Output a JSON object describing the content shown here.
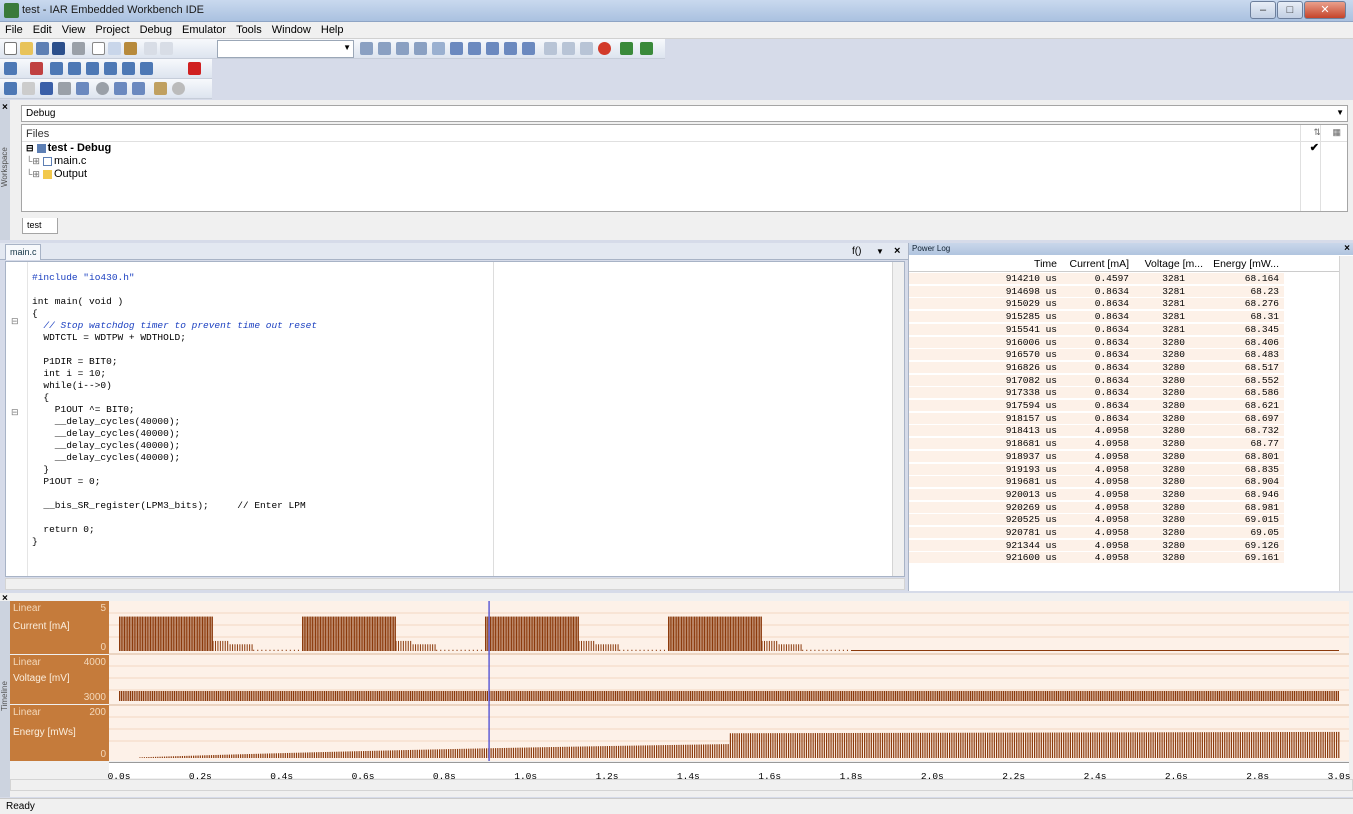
{
  "window": {
    "title": "test - IAR Embedded Workbench IDE"
  },
  "menu": [
    "File",
    "Edit",
    "View",
    "Project",
    "Debug",
    "Emulator",
    "Tools",
    "Window",
    "Help"
  ],
  "workspace": {
    "config": "Debug",
    "files_header": "Files",
    "project": "test - Debug",
    "items": [
      "main.c",
      "Output"
    ],
    "tab": "test",
    "sidebar_label": "Workspace"
  },
  "editor": {
    "tab": "main.c",
    "func_combo": "f()",
    "lines": [
      {
        "t": "#include \"io430.h\"",
        "k": "pre"
      },
      {
        "t": "",
        "k": ""
      },
      {
        "t": "int main( void )",
        "k": ""
      },
      {
        "t": "{",
        "k": ""
      },
      {
        "t": "  // Stop watchdog timer to prevent time out reset",
        "k": "c"
      },
      {
        "t": "  WDTCTL = WDTPW + WDTHOLD;",
        "k": ""
      },
      {
        "t": "",
        "k": ""
      },
      {
        "t": "  P1DIR = BIT0;",
        "k": ""
      },
      {
        "t": "  int i = 10;",
        "k": ""
      },
      {
        "t": "  while(i-->0)",
        "k": ""
      },
      {
        "t": "  {",
        "k": ""
      },
      {
        "t": "    P1OUT ^= BIT0;",
        "k": ""
      },
      {
        "t": "    __delay_cycles(40000);",
        "k": ""
      },
      {
        "t": "    __delay_cycles(40000);",
        "k": ""
      },
      {
        "t": "    __delay_cycles(40000);",
        "k": ""
      },
      {
        "t": "    __delay_cycles(40000);",
        "k": ""
      },
      {
        "t": "  }",
        "k": ""
      },
      {
        "t": "  P1OUT = 0;",
        "k": ""
      },
      {
        "t": "",
        "k": ""
      },
      {
        "t": "  __bis_SR_register(LPM3_bits);     // Enter LPM",
        "k": "tc"
      },
      {
        "t": "",
        "k": ""
      },
      {
        "t": "  return 0;",
        "k": ""
      },
      {
        "t": "}",
        "k": ""
      }
    ]
  },
  "powerlog": {
    "title": "Power Log",
    "columns": [
      "Time",
      "Current [mA]",
      "Voltage [m...",
      "Energy [mW..."
    ],
    "rows": [
      [
        "914210 us",
        "0.4597",
        "3281",
        "68.164"
      ],
      [
        "914698 us",
        "0.8634",
        "3281",
        "68.23"
      ],
      [
        "915029 us",
        "0.8634",
        "3281",
        "68.276"
      ],
      [
        "915285 us",
        "0.8634",
        "3281",
        "68.31"
      ],
      [
        "915541 us",
        "0.8634",
        "3281",
        "68.345"
      ],
      [
        "916006 us",
        "0.8634",
        "3280",
        "68.406"
      ],
      [
        "916570 us",
        "0.8634",
        "3280",
        "68.483"
      ],
      [
        "916826 us",
        "0.8634",
        "3280",
        "68.517"
      ],
      [
        "917082 us",
        "0.8634",
        "3280",
        "68.552"
      ],
      [
        "917338 us",
        "0.8634",
        "3280",
        "68.586"
      ],
      [
        "917594 us",
        "0.8634",
        "3280",
        "68.621"
      ],
      [
        "918157 us",
        "0.8634",
        "3280",
        "68.697"
      ],
      [
        "918413 us",
        "4.0958",
        "3280",
        "68.732"
      ],
      [
        "918681 us",
        "4.0958",
        "3280",
        "68.77"
      ],
      [
        "918937 us",
        "4.0958",
        "3280",
        "68.801"
      ],
      [
        "919193 us",
        "4.0958",
        "3280",
        "68.835"
      ],
      [
        "919681 us",
        "4.0958",
        "3280",
        "68.904"
      ],
      [
        "920013 us",
        "4.0958",
        "3280",
        "68.946"
      ],
      [
        "920269 us",
        "4.0958",
        "3280",
        "68.981"
      ],
      [
        "920525 us",
        "4.0958",
        "3280",
        "69.015"
      ],
      [
        "920781 us",
        "4.0958",
        "3280",
        "69.05"
      ],
      [
        "921344 us",
        "4.0958",
        "3280",
        "69.126"
      ],
      [
        "921600 us",
        "4.0958",
        "3280",
        "69.161"
      ]
    ]
  },
  "timeline": {
    "sidebar_label": "Timeline",
    "graphs": [
      {
        "mode": "Linear",
        "name": "Current [mA]",
        "max": "5",
        "min": "0"
      },
      {
        "mode": "Linear",
        "name": "Voltage [mV]",
        "max": "4000",
        "min": "3000"
      },
      {
        "mode": "Linear",
        "name": "Energy [mWs]",
        "max": "200",
        "min": "0"
      }
    ],
    "ticks": [
      "0.0s",
      "0.2s",
      "0.4s",
      "0.6s",
      "0.8s",
      "1.0s",
      "1.2s",
      "1.4s",
      "1.6s",
      "1.8s",
      "2.0s",
      "2.2s",
      "2.4s",
      "2.6s",
      "2.8s",
      "3.0s"
    ],
    "cursor_time": 0.91
  },
  "status": {
    "text": "Ready"
  },
  "colors": {
    "trace": "#8b3a0c",
    "graph_bg": "#fdf1e8",
    "label_bg": "#c57b3b",
    "cursor": "#3b3bd1"
  }
}
